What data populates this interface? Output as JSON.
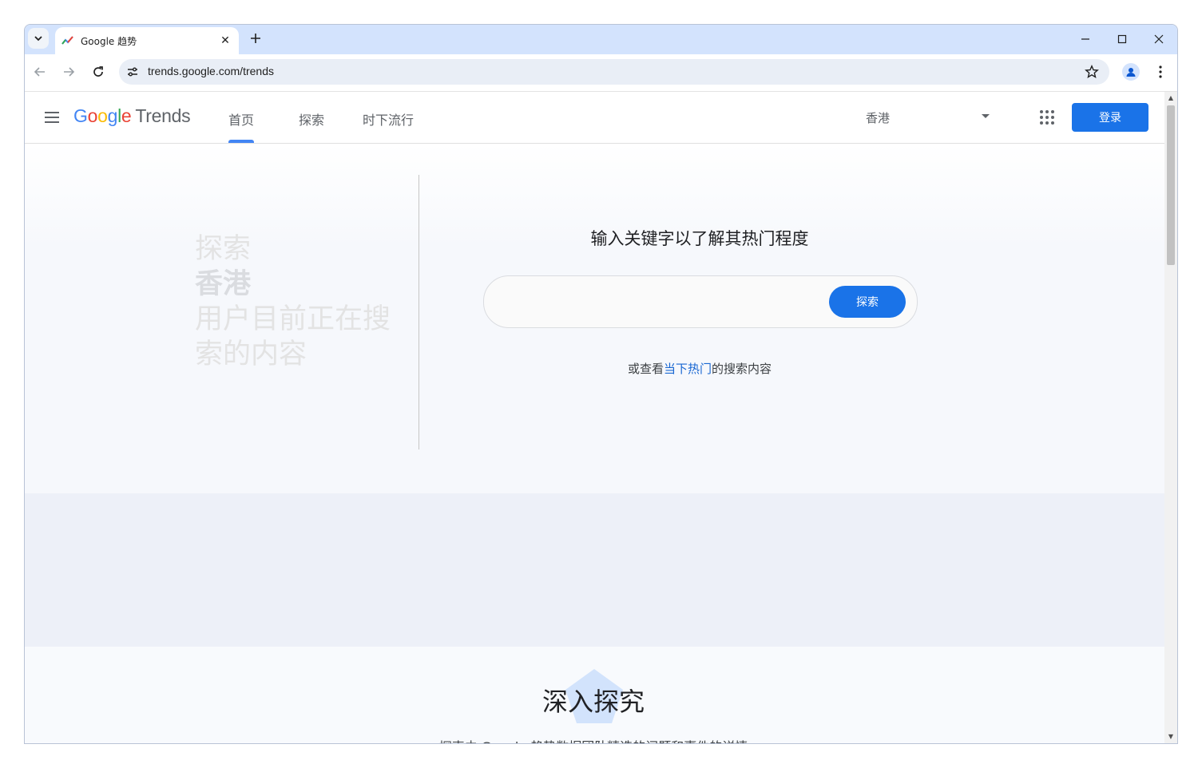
{
  "browser": {
    "tab_title": "Google 趋势",
    "url": "trends.google.com/trends"
  },
  "header": {
    "logo_google": "Google",
    "logo_trends": "Trends",
    "nav": [
      "首页",
      "探索",
      "时下流行"
    ],
    "region": "香港",
    "signin_label": "登录"
  },
  "hero": {
    "left_line1": "探索",
    "left_line2": "香港",
    "left_line3": "用户目前正在搜索的内容",
    "heading": "输入关键字以了解其热门程度",
    "search_placeholder": "",
    "search_button": "探索",
    "or_see_prefix": "或查看",
    "or_see_link": "当下热门",
    "or_see_suffix": "的搜索内容"
  },
  "lower": {
    "title": "深入探究",
    "subtitle": "探索由 Google 趋势数据团队精选的问题和事件的详情"
  },
  "colors": {
    "accent": "#1a73e8",
    "tab_strip": "#d3e3fd",
    "band": "#edf0f8"
  }
}
